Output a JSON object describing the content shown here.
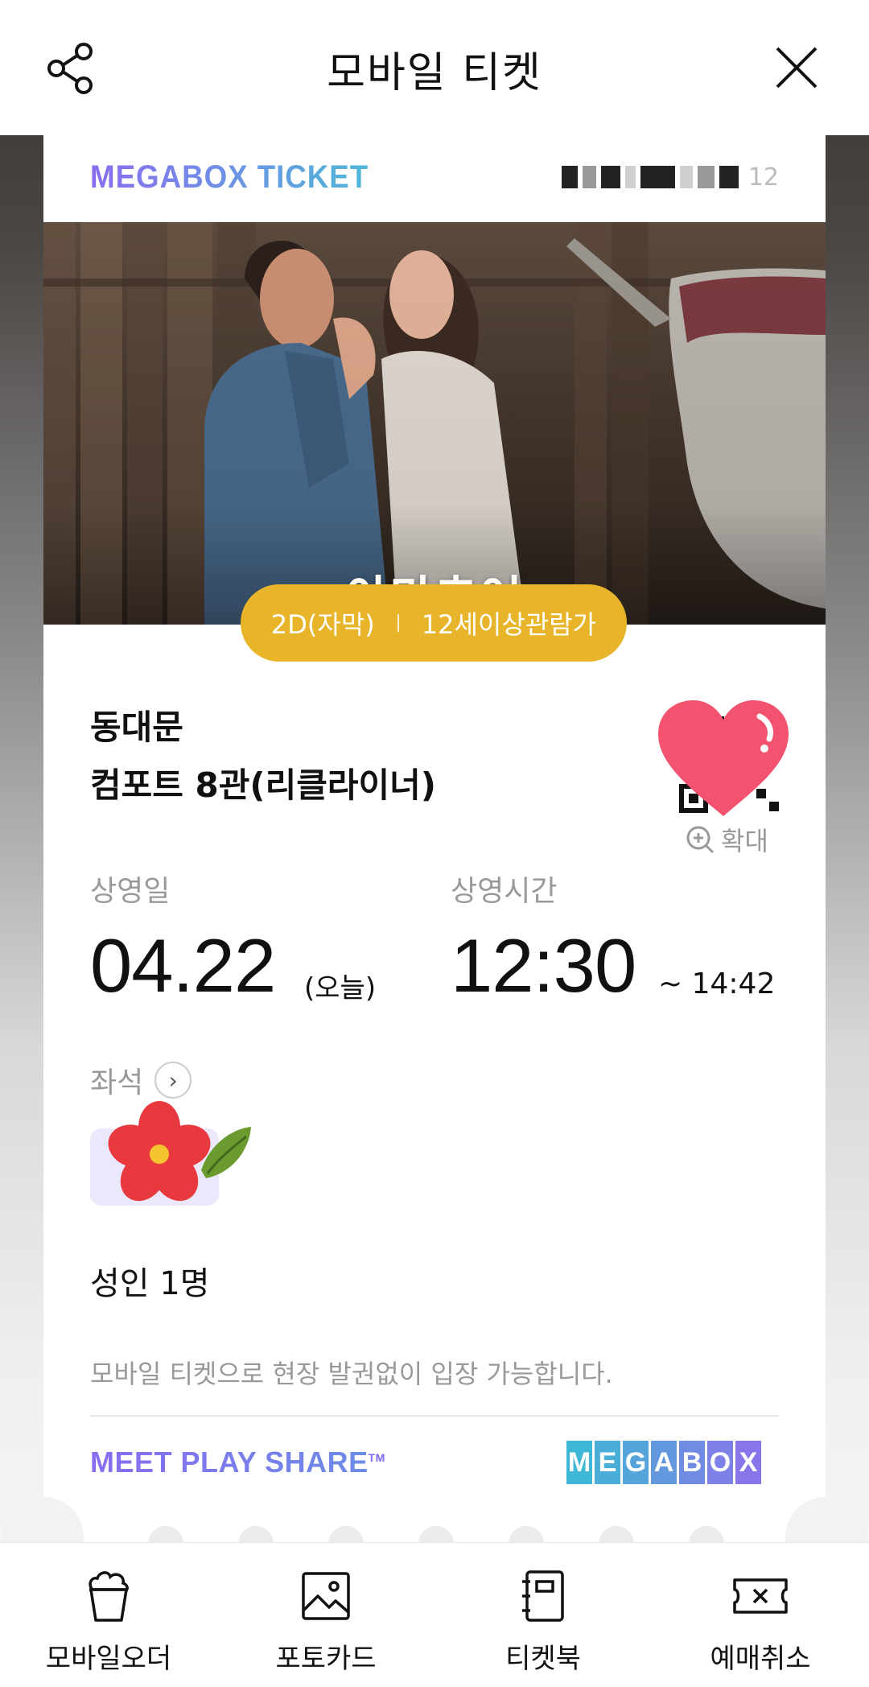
{
  "header": {
    "title": "모바일 티켓"
  },
  "ticket": {
    "brand": "MEGABOX TICKET",
    "number_tail": "12",
    "movie_title": "아마추어",
    "format": "2D(자막)",
    "rating": "12세이상관람가",
    "theater_line1": "동대문",
    "theater_line2": "컴포트 8관(리클라이너)",
    "zoom_label": "확대",
    "date_label": "상영일",
    "date_value": "04.22",
    "date_sub": "(오늘)",
    "time_label": "상영시간",
    "time_start": "12:30",
    "time_end": "~ 14:42",
    "seat_label": "좌석",
    "people": "성인 1명",
    "notice": "모바일 티켓으로 현장 발권없이 입장 가능합니다.",
    "slogan": "MEET PLAY SHARE",
    "slogan_tm": "TM",
    "logo_letters": [
      "M",
      "E",
      "G",
      "A",
      "B",
      "O",
      "X"
    ],
    "logo_colors": [
      "#3fb7d6",
      "#4aaed9",
      "#55a4db",
      "#6398df",
      "#6f8be2",
      "#7d80e6",
      "#8a74ea"
    ]
  },
  "bottom_nav": {
    "items": [
      {
        "label": "모바일오더",
        "icon": "popcorn-icon"
      },
      {
        "label": "포토카드",
        "icon": "photo-icon"
      },
      {
        "label": "티켓북",
        "icon": "ticketbook-icon"
      },
      {
        "label": "예매취소",
        "icon": "cancel-ticket-icon"
      }
    ]
  },
  "colors": {
    "accent_pill": "#e8b52a",
    "brand_purple": "#8a6cf0",
    "brand_cyan": "#4fb7d8"
  }
}
